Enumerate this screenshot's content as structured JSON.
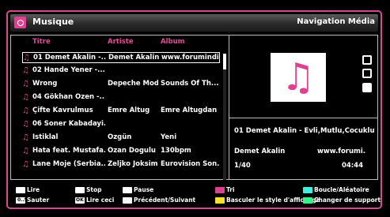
{
  "window": {
    "app_title": "Musique",
    "nav_title": "Navigation Média"
  },
  "table": {
    "headers": [
      "Titre",
      "Artiste",
      "Album"
    ],
    "rows": [
      {
        "title": "01 Demet Akalin -...",
        "artist": "Demet Akalin",
        "album": "www.forumindi..."
      },
      {
        "title": "02 Hande Yener -...",
        "artist": "",
        "album": ""
      },
      {
        "title": "Wrong",
        "artist": "Depeche Mode",
        "album": "Sounds Of Th..."
      },
      {
        "title": "04 Gökhan Özen -...",
        "artist": "",
        "album": ""
      },
      {
        "title": "Çifte Kavrulmus",
        "artist": "Emre Altug",
        "album": "Emre Altugdan"
      },
      {
        "title": "06 Soner Kabadayi...",
        "artist": "",
        "album": ""
      },
      {
        "title": "Istiklal",
        "artist": "Özgün",
        "album": "Yeni"
      },
      {
        "title": "Hata feat. Mustafa...",
        "artist": "Ozan Dogulu",
        "album": "130bpm"
      },
      {
        "title": "Lane Moje (Serbia...",
        "artist": "Zeljko Joksimo...",
        "album": "Eurovision Son..."
      }
    ]
  },
  "now_playing": {
    "title": "01 Demet Akalin - Evli,Mutlu,Cocuklu",
    "artist": "Demet Akalin",
    "album": "www.forumi...",
    "count": "1/40",
    "time": "04:44"
  },
  "legend": {
    "play": "Lire",
    "jump_key": "0..9",
    "jump": "Sauter",
    "stop": "Stop",
    "ok_key": "OK",
    "ok": "Lire ceci",
    "pause": "Pause",
    "prevnext": "Précédent/Suivant",
    "sort": "Tri",
    "view": "Basculer le style d'affichage",
    "loop": "Boucle/Aléatoire",
    "source": "Changer de support"
  }
}
